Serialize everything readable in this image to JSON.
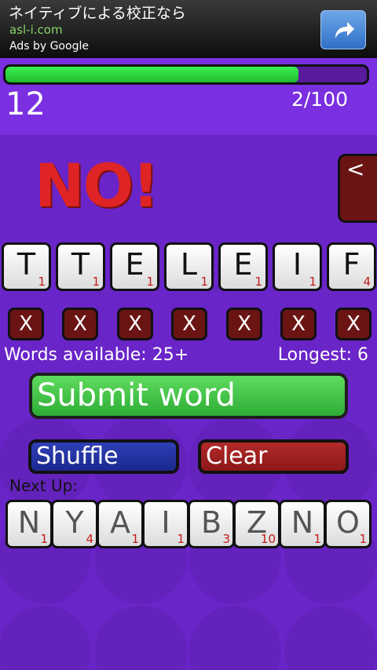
{
  "ad": {
    "title": "ネイティブによる校正なら",
    "url": "asl-i.com",
    "byline": "Ads by Google",
    "action_icon": "share-arrow-icon"
  },
  "progress": {
    "fraction": 0.81,
    "color": "#2ee045"
  },
  "score": "12",
  "word_count": "2/100",
  "feedback": "NO!",
  "back_label": "<",
  "tiles": [
    {
      "letter": "T",
      "points": "1"
    },
    {
      "letter": "T",
      "points": "1"
    },
    {
      "letter": "E",
      "points": "1"
    },
    {
      "letter": "L",
      "points": "1"
    },
    {
      "letter": "E",
      "points": "1"
    },
    {
      "letter": "I",
      "points": "1"
    },
    {
      "letter": "F",
      "points": "4"
    }
  ],
  "remove_label": "X",
  "words_available": "Words available: 25+",
  "longest": "Longest: 6",
  "submit_label": "Submit word",
  "shuffle_label": "Shuffle",
  "clear_label": "Clear",
  "next_up_label": "Next Up:",
  "next_tiles": [
    {
      "letter": "N",
      "points": "1"
    },
    {
      "letter": "Y",
      "points": "4"
    },
    {
      "letter": "A",
      "points": "1"
    },
    {
      "letter": "I",
      "points": "1"
    },
    {
      "letter": "B",
      "points": "3"
    },
    {
      "letter": "Z",
      "points": "10"
    },
    {
      "letter": "N",
      "points": "1"
    },
    {
      "letter": "O",
      "points": "1"
    }
  ]
}
